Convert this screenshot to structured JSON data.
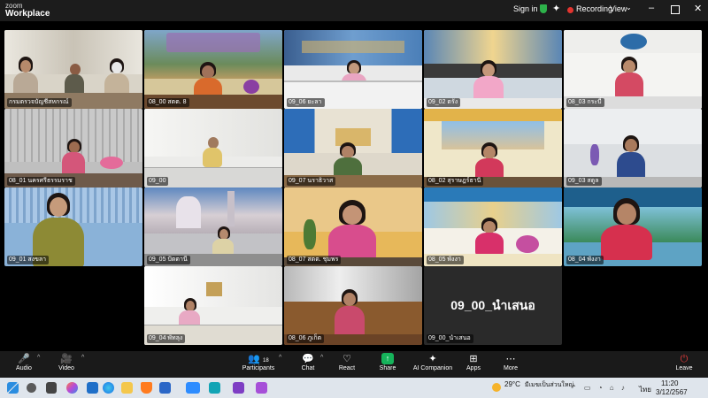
{
  "app": {
    "brand_small": "zoom",
    "brand_large": "Workplace"
  },
  "titlebar": {
    "signin": "Sign in",
    "recording": "Recording",
    "view": "View",
    "caret": "⌄",
    "minimize": "–",
    "close": "✕",
    "sparkle": "✦"
  },
  "participants": [
    {
      "name": "กรมตรวจบัญชีสหกรณ์"
    },
    {
      "name": "08_00 สตต. 8"
    },
    {
      "name": "09_06 ยะลา"
    },
    {
      "name": "09_02 ตรัง"
    },
    {
      "name": "08_03 กระบี่"
    },
    {
      "name": "08_01 นครศรีธรรมราช"
    },
    {
      "name": "09_00"
    },
    {
      "name": "09_07 นราธิวาส"
    },
    {
      "name": "08_02 สุราษฎร์ธานี"
    },
    {
      "name": "09_03 สตูล"
    },
    {
      "name": "09_01 สงขลา"
    },
    {
      "name": "09_05 ปัตตานี"
    },
    {
      "name": "08_07 สตต. ชุมพร"
    },
    {
      "name": "08_05 พังงา"
    },
    {
      "name": "08_04 พังงา"
    },
    {
      "name": "09_04 พัทลุง"
    },
    {
      "name": "08_06 ภูเก็ต"
    },
    {
      "name": "09_00_นำเสนอ"
    }
  ],
  "presenter_tile": {
    "big_name": "09_00_นำเสนอ"
  },
  "toolbar": {
    "audio": "Audio",
    "video": "Video",
    "participants": "Participants",
    "participants_count": "18",
    "chat": "Chat",
    "react": "React",
    "share": "Share",
    "ai_companion": "AI Companion",
    "apps": "Apps",
    "more": "More",
    "leave": "Leave",
    "caret": "^"
  },
  "taskbar": {
    "temperature": "29°C",
    "weather": "มีเมฆเป็นส่วนใหญ่",
    "language": "ไทย",
    "time": "11:20",
    "date": "3/12/2567"
  },
  "colors": {
    "active_speaker": "#35c76a",
    "recording": "#e3342f",
    "share": "#16b35b",
    "leave": "#e23b3b"
  }
}
